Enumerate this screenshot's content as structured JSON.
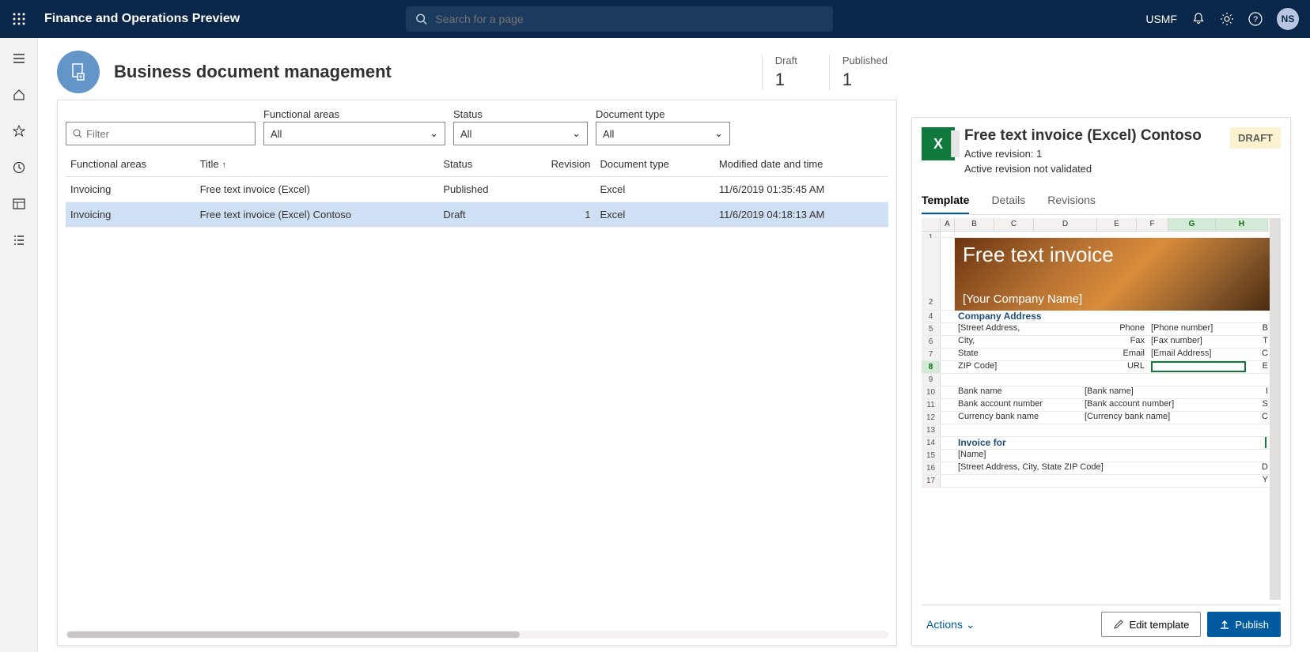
{
  "topbar": {
    "app_title": "Finance and Operations Preview",
    "search_placeholder": "Search for a page",
    "company": "USMF",
    "avatar": "NS"
  },
  "page": {
    "title": "Business document management",
    "counts": {
      "draft_label": "Draft",
      "draft_value": "1",
      "published_label": "Published",
      "published_value": "1"
    }
  },
  "filters": {
    "filter_placeholder": "Filter",
    "functional_areas_label": "Functional areas",
    "status_label": "Status",
    "doctype_label": "Document type",
    "all": "All"
  },
  "grid": {
    "columns": {
      "functional_areas": "Functional areas",
      "title": "Title",
      "status": "Status",
      "revision": "Revision",
      "doctype": "Document type",
      "modified": "Modified date and time"
    },
    "rows": [
      {
        "fa": "Invoicing",
        "title": "Free text invoice (Excel)",
        "status": "Published",
        "revision": "",
        "doctype": "Excel",
        "modified": "11/6/2019 01:35:45 AM"
      },
      {
        "fa": "Invoicing",
        "title": "Free text invoice (Excel) Contoso",
        "status": "Draft",
        "revision": "1",
        "doctype": "Excel",
        "modified": "11/6/2019 04:18:13 AM"
      }
    ]
  },
  "details": {
    "title": "Free text invoice (Excel) Contoso",
    "active_revision": "Active revision: 1",
    "validation": "Active revision not validated",
    "badge": "DRAFT",
    "tabs": {
      "template": "Template",
      "details": "Details",
      "revisions": "Revisions"
    },
    "actions_label": "Actions",
    "edit_label": "Edit template",
    "publish_label": "Publish"
  },
  "excel": {
    "cols": [
      "A",
      "B",
      "C",
      "D",
      "E",
      "F",
      "G",
      "H"
    ],
    "banner_title": "Free text invoice",
    "banner_sub": "[Your Company Name]",
    "section_company": "Company Address",
    "street": "[Street Address,",
    "city": "City,",
    "state": "State",
    "zip": "ZIP Code]",
    "phone_l": "Phone",
    "phone_v": "[Phone number]",
    "fax_l": "Fax",
    "fax_v": "[Fax number]",
    "email_l": "Email",
    "email_v": "[Email Address]",
    "url_l": "URL",
    "bank_name_l": "Bank name",
    "bank_name_v": "[Bank name]",
    "bank_acct_l": "Bank account number",
    "bank_acct_v": "[Bank account number]",
    "currency_l": "Currency bank name",
    "currency_v": "[Currency bank name]",
    "invoice_for": "Invoice for",
    "name": "[Name]",
    "addr2": "[Street Address, City, State ZIP Code]",
    "edge": {
      "b": "B",
      "t": "T",
      "c": "C",
      "e": "E",
      "i": "I",
      "s": "S",
      "d": "D",
      "y": "Y",
      "c2": "C"
    }
  }
}
